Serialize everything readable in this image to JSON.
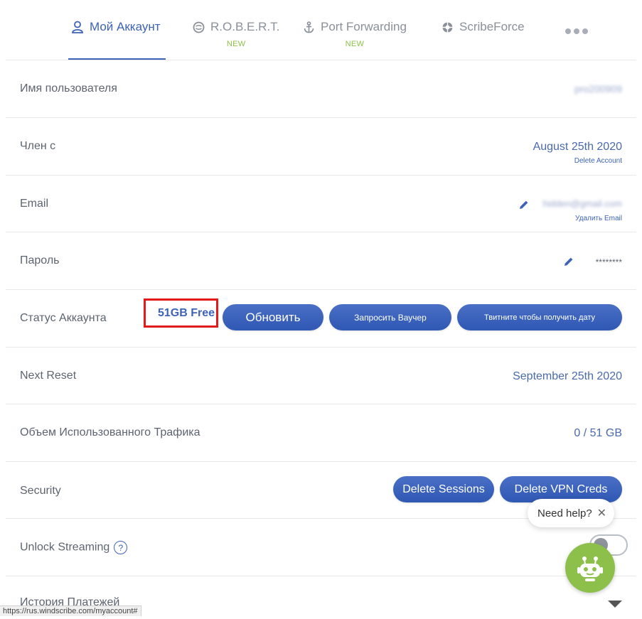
{
  "tabs": [
    {
      "label": "Мой Аккаунт",
      "icon": "user-icon",
      "badge": "",
      "active": true
    },
    {
      "label": "R.O.B.E.R.T.",
      "icon": "robert-shield-icon",
      "badge": "NEW",
      "active": false
    },
    {
      "label": "Port Forwarding",
      "icon": "anchor-icon",
      "badge": "NEW",
      "active": false
    },
    {
      "label": "ScribeForce",
      "icon": "scribeforce-icon",
      "badge": "",
      "active": false
    }
  ],
  "more_icon": "more-dots-icon",
  "account": {
    "username": {
      "label": "Имя пользователя",
      "value": "pro200909"
    },
    "member_since": {
      "label": "Член с",
      "value": "August 25th 2020",
      "link": "Delete Account"
    },
    "email": {
      "label": "Email",
      "value": "hidden@gmail.com",
      "link": "Удалить Email",
      "edit_icon": "pencil-icon"
    },
    "password": {
      "label": "Пароль",
      "value": "********",
      "edit_icon": "pencil-icon"
    },
    "status": {
      "label": "Статус Аккаунта",
      "value": "51GB Free",
      "buttons": {
        "upgrade": "Обновить",
        "voucher": "Запросить Ваучер",
        "tweet": "Твитните чтобы получить дату"
      }
    },
    "next_reset": {
      "label": "Next Reset",
      "value": "September 25th 2020"
    },
    "traffic": {
      "label": "Объем Использованного Трафика",
      "value": "0 / 51 GB"
    },
    "security": {
      "label": "Security",
      "buttons": {
        "delete_sessions": "Delete Sessions",
        "delete_vpn_creds": "Delete VPN Creds"
      }
    },
    "streaming": {
      "label": "Unlock Streaming",
      "help": "?",
      "enabled": false
    },
    "payments": {
      "label": "История Платежей"
    }
  },
  "chat": {
    "bubble": "Need help?",
    "close": "✕",
    "bot_icon": "robot-icon"
  },
  "status_bar_url": "https://rus.windscribe.com/myaccount#",
  "colors": {
    "accent": "#3d63b8",
    "new_badge": "#8cc04a",
    "highlight_box": "#e41a1a",
    "chat_bot": "#8cc04a"
  }
}
